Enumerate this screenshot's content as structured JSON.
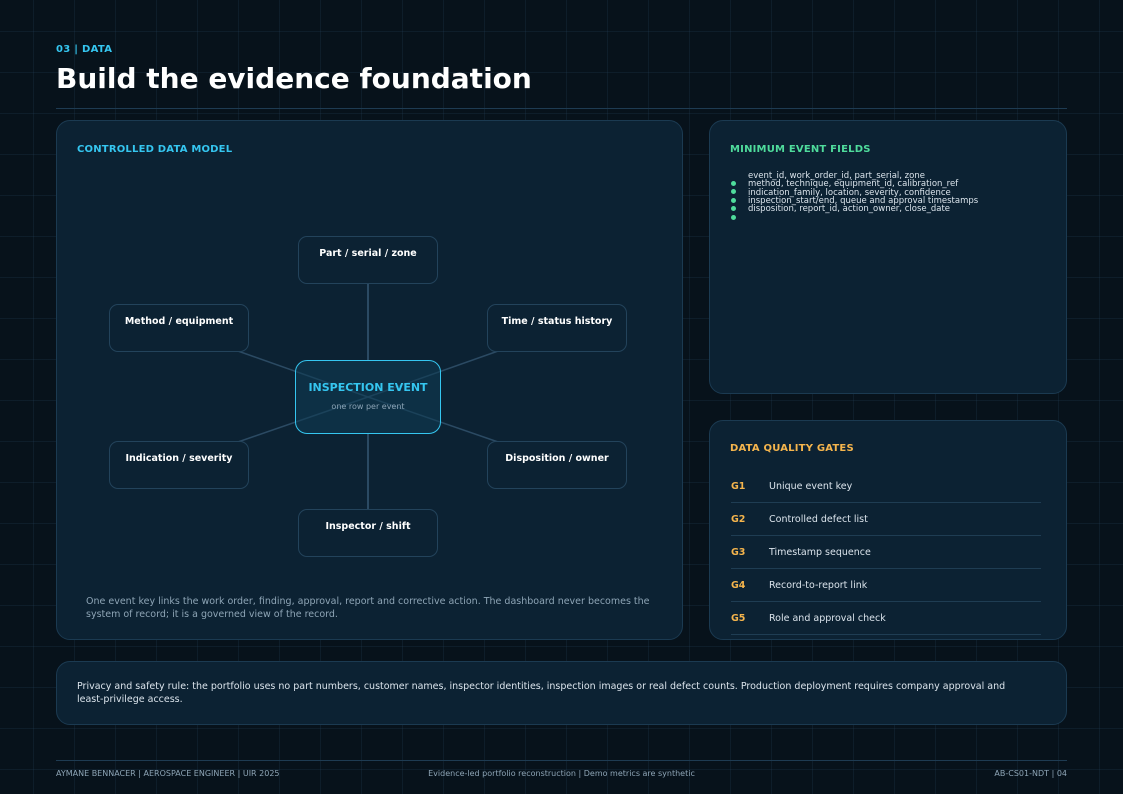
{
  "header": {
    "eyebrow": "03 | DATA",
    "title": "Build the evidence foundation"
  },
  "data_model": {
    "heading": "CONTROLLED DATA MODEL",
    "center": {
      "title": "INSPECTION EVENT",
      "subtitle": "one row per event"
    },
    "nodes": {
      "top": "Part / serial / zone",
      "upper_left": "Method / equipment",
      "upper_right": "Time / status history",
      "lower_left": "Indication / severity",
      "lower_right": "Disposition / owner",
      "bottom": "Inspector / shift"
    },
    "caption": "One event key links the work order, finding, approval, report and corrective action. The dashboard never becomes the system of record; it is a governed view of the record."
  },
  "event_fields": {
    "heading": "MINIMUM EVENT FIELDS",
    "items": [
      "event_id, work_order_id, part_serial, zone",
      "method, technique, equipment_id, calibration_ref",
      "indication_family, location, severity, confidence",
      "inspection_start/end, queue and approval timestamps",
      "disposition, report_id, action_owner, close_date"
    ],
    "bullet_color": "#4fdc9c"
  },
  "quality_gates": {
    "heading": "DATA QUALITY GATES",
    "gates": [
      {
        "id": "G1",
        "label": "Unique event key"
      },
      {
        "id": "G2",
        "label": "Controlled defect list"
      },
      {
        "id": "G3",
        "label": "Timestamp sequence"
      },
      {
        "id": "G4",
        "label": "Record-to-report link"
      },
      {
        "id": "G5",
        "label": "Role and approval check"
      }
    ]
  },
  "privacy": {
    "text": "Privacy and safety rule: the portfolio uses no part numbers, customer names, inspector identities, inspection images or real defect counts. Production deployment requires company approval and least-privilege access."
  },
  "footer": {
    "left": "AYMANE BENNACER | AEROSPACE ENGINEER | UIR 2025",
    "center": "Evidence-led portfolio reconstruction | Demo metrics are synthetic",
    "right": "AB-CS01-NDT | 04"
  },
  "colors": {
    "accent_cyan": "#35c6f0",
    "accent_green": "#4fdc9c",
    "accent_amber": "#f5b54d",
    "background": "#07121b",
    "panel": "#0c2233"
  }
}
